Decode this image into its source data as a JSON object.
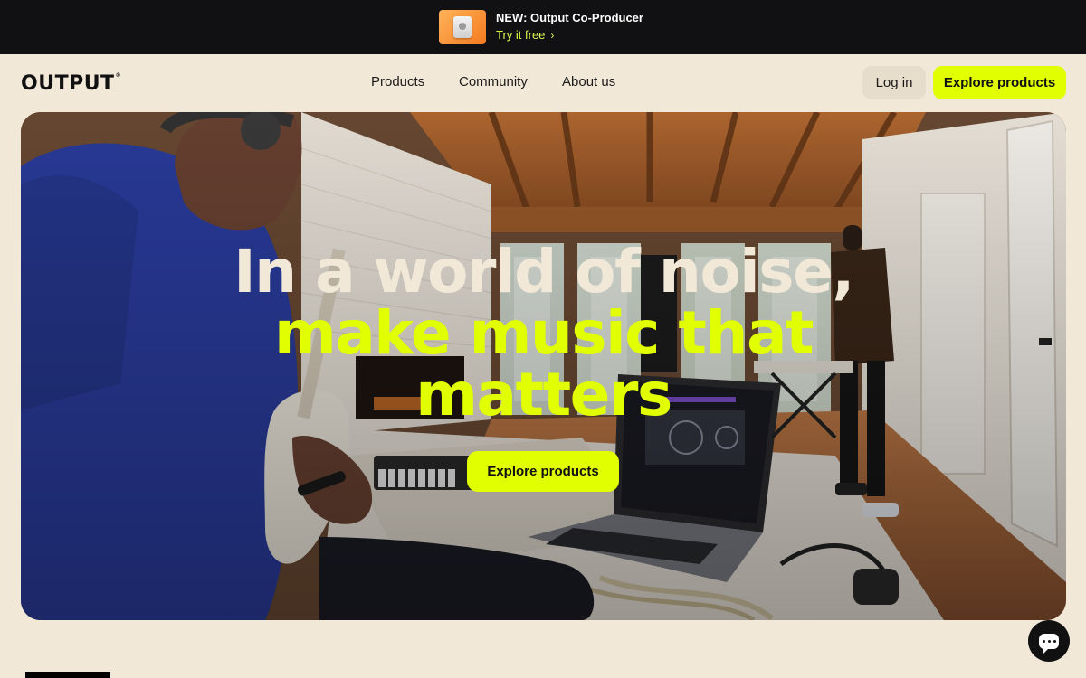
{
  "promo": {
    "title": "NEW: Output Co-Producer",
    "link_label": "Try it free",
    "thumb_icon": "co-producer-device-icon"
  },
  "header": {
    "logo": "OUTPUT",
    "logo_mark": "®",
    "nav": [
      "Products",
      "Community",
      "About us"
    ],
    "login_label": "Log in",
    "cta_label": "Explore products"
  },
  "hero": {
    "line1": "In a world of noise,",
    "line2": "make music that",
    "line3": "matters",
    "cta_label": "Explore products"
  },
  "chat": {
    "icon": "chat-bubble-icon"
  },
  "colors": {
    "accent": "#e1ff00",
    "background": "#f2e8d8",
    "promo_bg": "#111113",
    "promo_link": "#d9f84a"
  }
}
